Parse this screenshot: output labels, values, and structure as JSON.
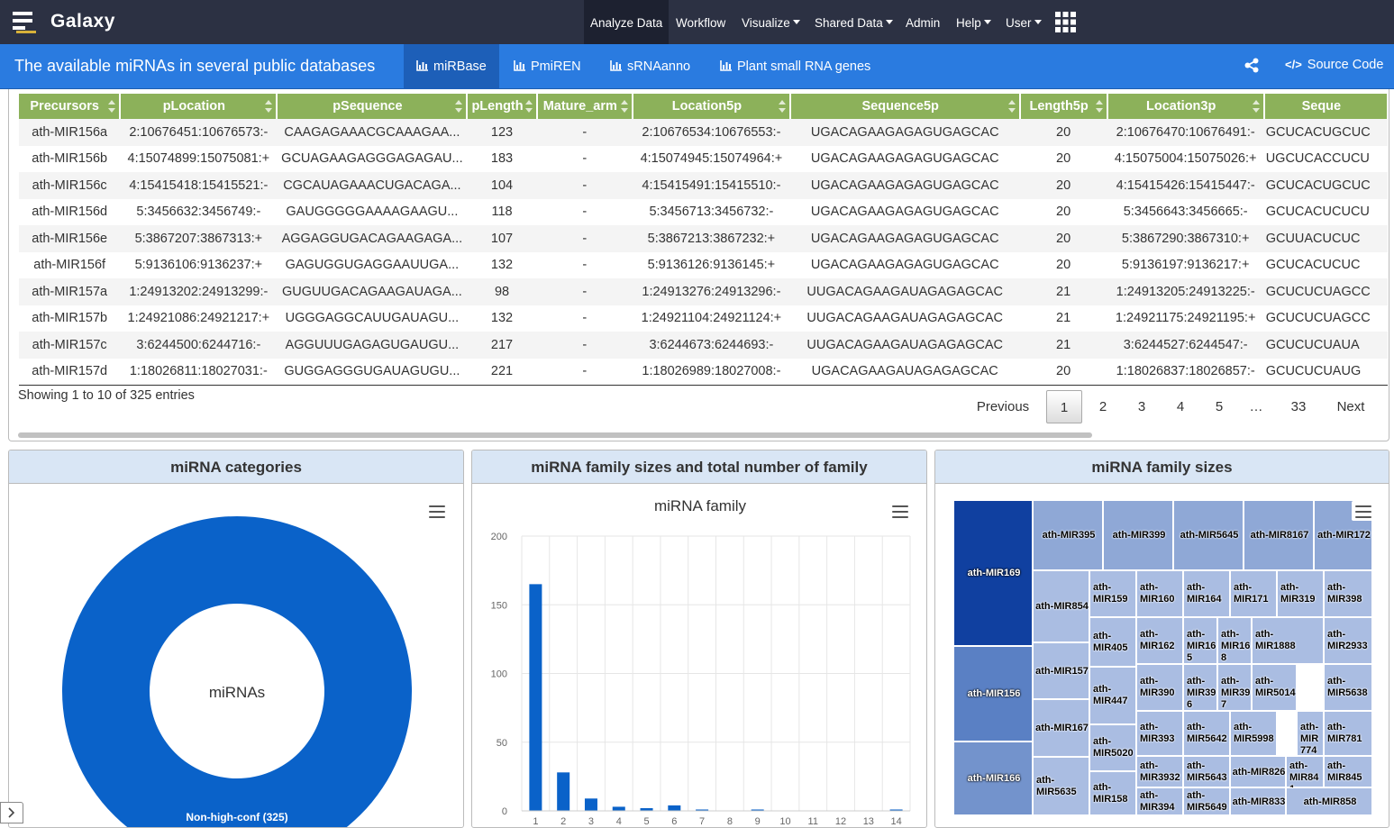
{
  "brand": "Galaxy",
  "nav": {
    "analyze": "Analyze Data",
    "workflow": "Workflow",
    "visualize": "Visualize",
    "shared": "Shared Data",
    "admin": "Admin",
    "help": "Help",
    "user": "User"
  },
  "page_title": "The available miRNAs in several public databases",
  "tabs": [
    "miRBase",
    "PmiREN",
    "sRNAanno",
    "Plant small RNA genes"
  ],
  "source_code": "Source Code",
  "table": {
    "columns": [
      "Precursors",
      "pLocation",
      "pSequence",
      "pLength",
      "Mature_arm",
      "Location5p",
      "Sequence5p",
      "Length5p",
      "Location3p",
      "Seque"
    ],
    "rows": [
      [
        "ath-MIR156a",
        "2:10676451:10676573:-",
        "CAAGAGAAACGCAAAGAA...",
        "123",
        "-",
        "2:10676534:10676553:-",
        "UGACAGAAGAGAGUGAGCAC",
        "20",
        "2:10676470:10676491:-",
        "GCUCACUGCUC"
      ],
      [
        "ath-MIR156b",
        "4:15074899:15075081:+",
        "GCUAGAAGAGGGAGAGAU...",
        "183",
        "-",
        "4:15074945:15074964:+",
        "UGACAGAAGAGAGUGAGCAC",
        "20",
        "4:15075004:15075026:+",
        "UGCUCACCUCU"
      ],
      [
        "ath-MIR156c",
        "4:15415418:15415521:-",
        "CGCAUAGAAACUGACAGA...",
        "104",
        "-",
        "4:15415491:15415510:-",
        "UGACAGAAGAGAGUGAGCAC",
        "20",
        "4:15415426:15415447:-",
        "GCUCACUGCUC"
      ],
      [
        "ath-MIR156d",
        "5:3456632:3456749:-",
        "GAUGGGGGAAAAGAAGU...",
        "118",
        "-",
        "5:3456713:3456732:-",
        "UGACAGAAGAGAGUGAGCAC",
        "20",
        "5:3456643:3456665:-",
        "GCUCACUCUCU"
      ],
      [
        "ath-MIR156e",
        "5:3867207:3867313:+",
        "AGGAGGUGACAGAAGAGA...",
        "107",
        "-",
        "5:3867213:3867232:+",
        "UGACAGAAGAGAGUGAGCAC",
        "20",
        "5:3867290:3867310:+",
        "GCUUACUCUC"
      ],
      [
        "ath-MIR156f",
        "5:9136106:9136237:+",
        "GAGUGGUGAGGAAUUGA...",
        "132",
        "-",
        "5:9136126:9136145:+",
        "UGACAGAAGAGAGUGAGCAC",
        "20",
        "5:9136197:9136217:+",
        "GCUCACUCUC"
      ],
      [
        "ath-MIR157a",
        "1:24913202:24913299:-",
        "GUGUUGACAGAAGAUAGA...",
        "98",
        "-",
        "1:24913276:24913296:-",
        "UUGACAGAAGAUAGAGAGCAC",
        "21",
        "1:24913205:24913225:-",
        "GCUCUCUAGCC"
      ],
      [
        "ath-MIR157b",
        "1:24921086:24921217:+",
        "UGGGAGGCAUUGAUAGU...",
        "132",
        "-",
        "1:24921104:24921124:+",
        "UUGACAGAAGAUAGAGAGCAC",
        "21",
        "1:24921175:24921195:+",
        "GCUCUCUAGCC"
      ],
      [
        "ath-MIR157c",
        "3:6244500:6244716:-",
        "AGGUUUGAGAGUGAUGU...",
        "217",
        "-",
        "3:6244673:6244693:-",
        "UUGACAGAAGAUAGAGAGCAC",
        "21",
        "3:6244527:6244547:-",
        "GCUCUCUAUA"
      ],
      [
        "ath-MIR157d",
        "1:18026811:18027031:-",
        "GUGGAGGGUGAUAGUGU...",
        "221",
        "-",
        "1:18026989:18027008:-",
        "UGACAGAAGAUAGAGAGCAC",
        "20",
        "1:18026837:18026857:-",
        "GCUCUCUAUG"
      ]
    ],
    "info": "Showing 1 to 10 of 325 entries",
    "pagination": [
      "Previous",
      "1",
      "2",
      "3",
      "4",
      "5",
      "…",
      "33",
      "Next"
    ]
  },
  "panels": {
    "categories": {
      "title": "miRNA categories",
      "center_label": "miRNAs",
      "slice_label": "Non-high-conf (325)"
    },
    "family_sizes_total": {
      "title": "miRNA family sizes and total number of family",
      "chart_title": "miRNA family"
    },
    "family_sizes": {
      "title": "miRNA family sizes"
    }
  },
  "chart_data": [
    {
      "type": "pie",
      "title": "",
      "center_label": "miRNAs",
      "slices": [
        {
          "name": "Non-high-conf",
          "value": 325
        }
      ],
      "colors": [
        "#0a62c9"
      ]
    },
    {
      "type": "bar",
      "title": "miRNA family",
      "categories": [
        "1",
        "2",
        "3",
        "4",
        "5",
        "6",
        "7",
        "8",
        "9",
        "10",
        "11",
        "12",
        "13",
        "14"
      ],
      "values": [
        165,
        28,
        9,
        3,
        2,
        4,
        1,
        0,
        1,
        0,
        0,
        0,
        0,
        1
      ],
      "ylim": [
        0,
        200
      ],
      "yticks": [
        0,
        50,
        100,
        150,
        200
      ],
      "color": "#0a62c9",
      "grid": true
    },
    {
      "type": "treemap",
      "title": "",
      "labels": [
        "ath-MIR169",
        "ath-MIR156",
        "ath-MIR166",
        "ath-MIR395",
        "ath-MIR399",
        "ath-MIR5645",
        "ath-MIR8167",
        "ath-MIR172",
        "ath-MIR854",
        "ath-MIR157",
        "ath-MIR167",
        "ath-MIR5635",
        "ath-MIR159",
        "ath-MIR405",
        "ath-MIR447",
        "ath-MIR5020",
        "ath-MIR158",
        "ath-MIR160",
        "ath-MIR162",
        "ath-MIR390",
        "ath-MIR393",
        "ath-MIR3932",
        "ath-MIR394",
        "ath-MIR164",
        "ath-MIR165",
        "ath-MIR396",
        "ath-MIR5642",
        "ath-MIR5643",
        "ath-MIR5649",
        "ath-MIR171",
        "ath-MIR168",
        "ath-MIR397",
        "ath-MIR5998",
        "ath-MIR826",
        "ath-MIR833",
        "ath-MIR319",
        "ath-MIR1888",
        "ath-MIR5014",
        "ath-MIR774",
        "ath-MIR841",
        "ath-MIR398",
        "ath-MIR2933",
        "ath-MIR5638",
        "ath-MIR781",
        "ath-MIR845",
        "ath-MIR858"
      ]
    }
  ]
}
